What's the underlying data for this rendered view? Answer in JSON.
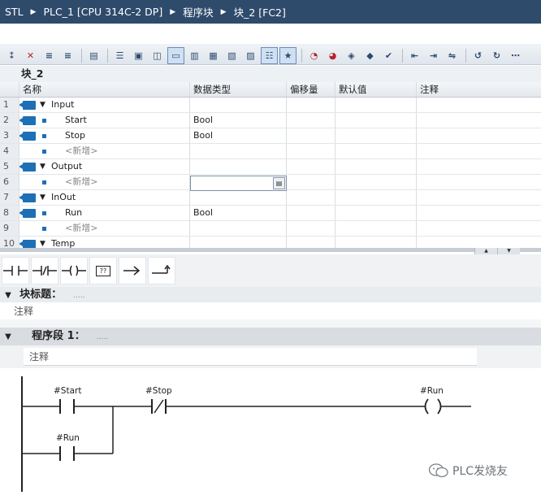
{
  "breadcrumb": [
    "STL",
    "PLC_1 [CPU 314C-2 DP]",
    "程序块",
    "块_2 [FC2]"
  ],
  "block_name": "块_2",
  "table": {
    "headers": [
      "名称",
      "数据类型",
      "偏移量",
      "默认值",
      "注释"
    ],
    "rows": [
      {
        "num": "1",
        "name": "Input",
        "type": "",
        "kind": "section"
      },
      {
        "num": "2",
        "name": "Start",
        "type": "Bool",
        "kind": "var"
      },
      {
        "num": "3",
        "name": "Stop",
        "type": "Bool",
        "kind": "var"
      },
      {
        "num": "4",
        "name": "<新增>",
        "type": "",
        "kind": "new"
      },
      {
        "num": "5",
        "name": "Output",
        "type": "",
        "kind": "section"
      },
      {
        "num": "6",
        "name": "<新增>",
        "type": "",
        "kind": "new"
      },
      {
        "num": "7",
        "name": "InOut",
        "type": "",
        "kind": "section"
      },
      {
        "num": "8",
        "name": "Run",
        "type": "Bool",
        "kind": "var"
      },
      {
        "num": "9",
        "name": "<新增>",
        "type": "",
        "kind": "new"
      },
      {
        "num": "10",
        "name": "Temp",
        "type": "",
        "kind": "section"
      }
    ]
  },
  "block_title": {
    "label": "块标题：",
    "dots": ".....",
    "comment": "注释"
  },
  "network": {
    "label": "程序段 1：",
    "dots": ".....",
    "comment": "注释"
  },
  "ladder": {
    "start": "#Start",
    "stop": "#Stop",
    "run_coil": "#Run",
    "run_contact": "#Run"
  },
  "watermark": "PLC发烧友",
  "colors": {
    "titlebar": "#2f4b6c",
    "accent": "#1e6fb6"
  }
}
